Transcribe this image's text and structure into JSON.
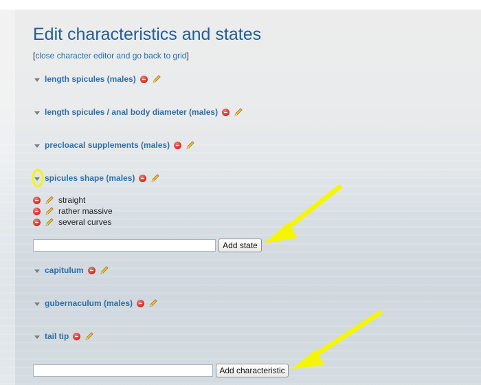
{
  "page": {
    "title": "Edit characteristics and states",
    "back_link": {
      "open_bracket": "[",
      "label": "close character editor and go back to grid",
      "close_bracket": "]"
    }
  },
  "characters": [
    {
      "label": "length spicules (males)"
    },
    {
      "label": "length spicules / anal body diameter (males)"
    },
    {
      "label": "precloacal supplements (males)"
    },
    {
      "label": "spicules shape (males)",
      "expanded": true,
      "states": [
        {
          "label": "straight"
        },
        {
          "label": "rather massive"
        },
        {
          "label": "several curves"
        }
      ]
    },
    {
      "label": "capitulum"
    },
    {
      "label": "gubernaculum (males)"
    },
    {
      "label": "tail tip"
    }
  ],
  "add_state": {
    "value": "",
    "button_label": "Add state"
  },
  "add_characteristic": {
    "value": "",
    "button_label": "Add characteristic"
  },
  "icons": {
    "delete": "delete-icon",
    "edit": "pencil-icon",
    "toggle": "triangle-down-icon"
  },
  "colors": {
    "title": "#1f5f9a",
    "link": "#1f6fb0",
    "char_label": "#2f6fa8",
    "annotation": "#f5f50a"
  }
}
